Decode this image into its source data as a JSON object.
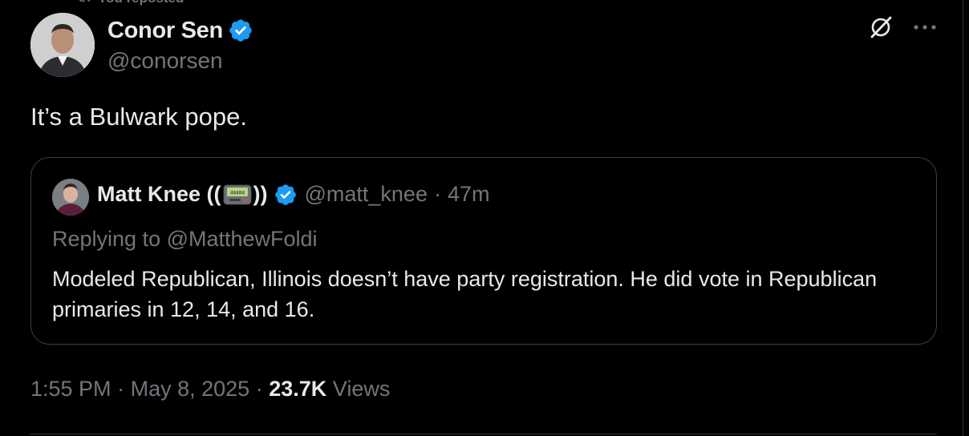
{
  "repost_banner": {
    "label": "You reposted"
  },
  "author": {
    "display_name": "Conor Sen",
    "handle": "@conorsen",
    "verified": true
  },
  "tweet": {
    "text": "It’s a Bulwark pope."
  },
  "quoted_tweet": {
    "author_name": "Matt Knee ((",
    "author_name_suffix": "))",
    "pager_text": "40404",
    "handle": "@matt_knee",
    "separator": "·",
    "time": "47m",
    "replying_to": "Replying to @MatthewFoldi",
    "body": "Modeled Republican, Illinois doesn’t have party registration. He did vote in Republican primaries in 12, 14, and 16."
  },
  "footer": {
    "time": "1:55 PM",
    "sep1": "·",
    "date": "May 8, 2025",
    "sep2": "·",
    "views_count": "23.7K",
    "views_label": "Views"
  },
  "icons": {
    "verified": "verified-badge-icon",
    "grok": "grok-icon",
    "more": "more-icon",
    "repost": "repost-icon",
    "pager": "pager-emoji-icon"
  },
  "colors": {
    "background": "#000000",
    "text": "#e7e9ea",
    "secondary": "#71767b",
    "verified": "#1d9bf0",
    "border": "#2f3336"
  }
}
